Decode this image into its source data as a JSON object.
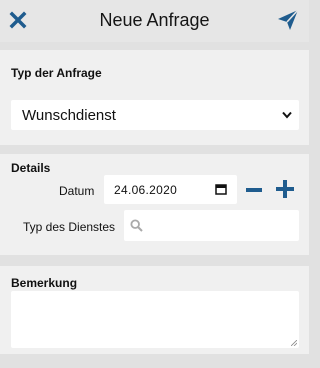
{
  "header": {
    "title": "Neue Anfrage",
    "close_icon": "close-icon",
    "send_icon": "send-icon",
    "accent_color": "#1f5c8e"
  },
  "request_type": {
    "label": "Typ der Anfrage",
    "selected": "Wunschdienst"
  },
  "details": {
    "label": "Details",
    "date_label": "Datum",
    "date_value": "24.06.2020",
    "service_type_label": "Typ des Dienstes",
    "service_type_value": ""
  },
  "remark": {
    "label": "Bemerkung",
    "value": ""
  }
}
